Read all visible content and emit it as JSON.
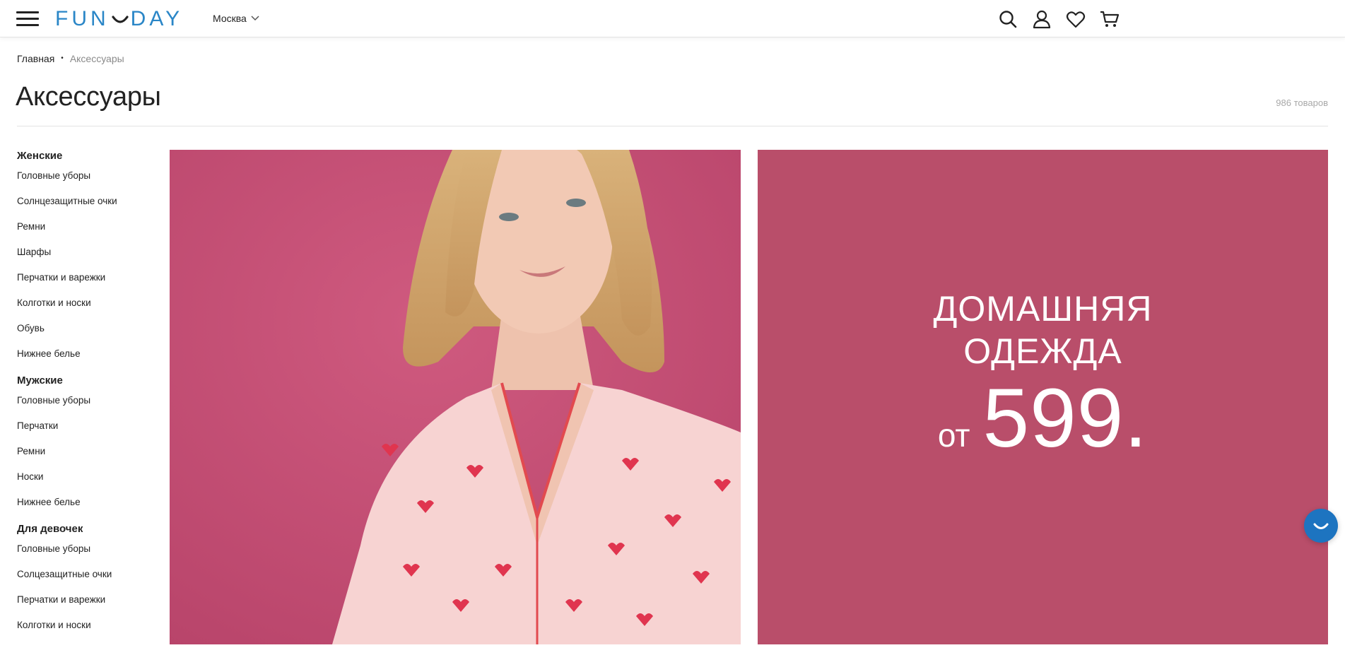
{
  "header": {
    "logo_text_left": "FUN",
    "logo_text_right": "DAY",
    "city": "Москва",
    "brand_color": "#2a86c7",
    "icons": [
      "search-icon",
      "user-icon",
      "heart-icon",
      "cart-icon"
    ]
  },
  "breadcrumb": {
    "home": "Главная",
    "separator": "•",
    "current": "Аксессуары"
  },
  "page": {
    "title": "Аксессуары",
    "count": "986 товаров"
  },
  "sidebar": {
    "groups": [
      {
        "heading": "Женские",
        "items": [
          "Головные уборы",
          "Солнцезащитные очки",
          "Ремни",
          "Шарфы",
          "Перчатки и варежки",
          "Колготки и носки",
          "Обувь",
          "Нижнее белье"
        ]
      },
      {
        "heading": "Мужские",
        "items": [
          "Головные уборы",
          "Перчатки",
          "Ремни",
          "Носки",
          "Нижнее белье"
        ]
      },
      {
        "heading": "Для девочек",
        "items": [
          "Головные уборы",
          "Солцезащитные очки",
          "Перчатки и варежки",
          "Колготки и носки"
        ]
      }
    ]
  },
  "promo": {
    "line1": "ДОМАШНЯЯ",
    "line2": "ОДЕЖДА",
    "from": "от",
    "price": "599."
  },
  "colors": {
    "banner_left": "#c44d72",
    "banner_right": "#b94e6a",
    "chat": "#1d74c0"
  }
}
